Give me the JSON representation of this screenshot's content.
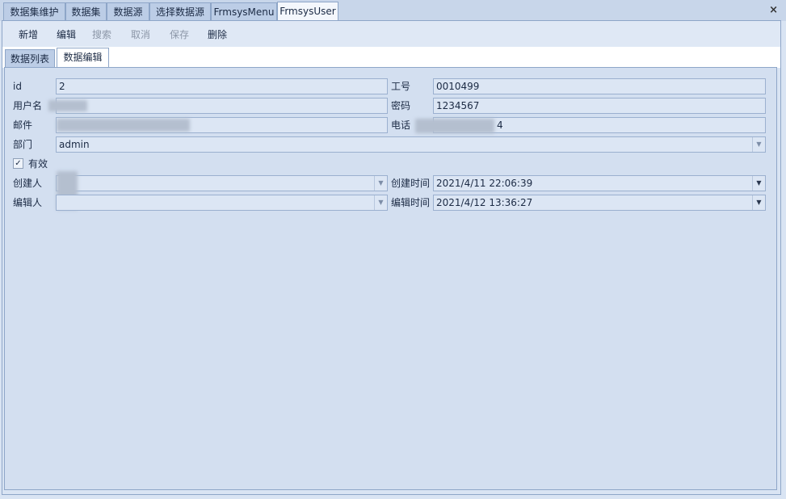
{
  "doc_tabs": [
    {
      "label": "数据集维护",
      "active": false
    },
    {
      "label": "数据集",
      "active": false
    },
    {
      "label": "数据源",
      "active": false
    },
    {
      "label": "选择数据源",
      "active": false
    },
    {
      "label": "FrmsysMenu",
      "active": false
    },
    {
      "label": "FrmsysUser",
      "active": true
    }
  ],
  "close_symbol": "×",
  "toolbar": {
    "add": "新增",
    "edit": "编辑",
    "search": "搜索",
    "cancel": "取消",
    "save": "保存",
    "delete": "删除"
  },
  "sub_tabs": {
    "list": "数据列表",
    "edit": "数据编辑"
  },
  "form": {
    "id_label": "id",
    "id_value": "2",
    "job_no_label": "工号",
    "job_no_value": "0010499",
    "username_label": "用户名",
    "username_value": "",
    "password_label": "密码",
    "password_value": "1234567",
    "email_label": "邮件",
    "email_value": "",
    "phone_label": "电话",
    "phone_value": "4",
    "dept_label": "部门",
    "dept_value": "admin",
    "valid_label": "有效",
    "valid_checked": true,
    "creator_label": "创建人",
    "creator_value": "",
    "create_time_label": "创建时间",
    "create_time_value": "2021/4/11 22:06:39",
    "editor_label": "编辑人",
    "editor_value": "",
    "edit_time_label": "编辑时间",
    "edit_time_value": "2021/4/12 13:36:27"
  },
  "icons": {
    "checkbox": "✓",
    "dropdown": "▼"
  }
}
